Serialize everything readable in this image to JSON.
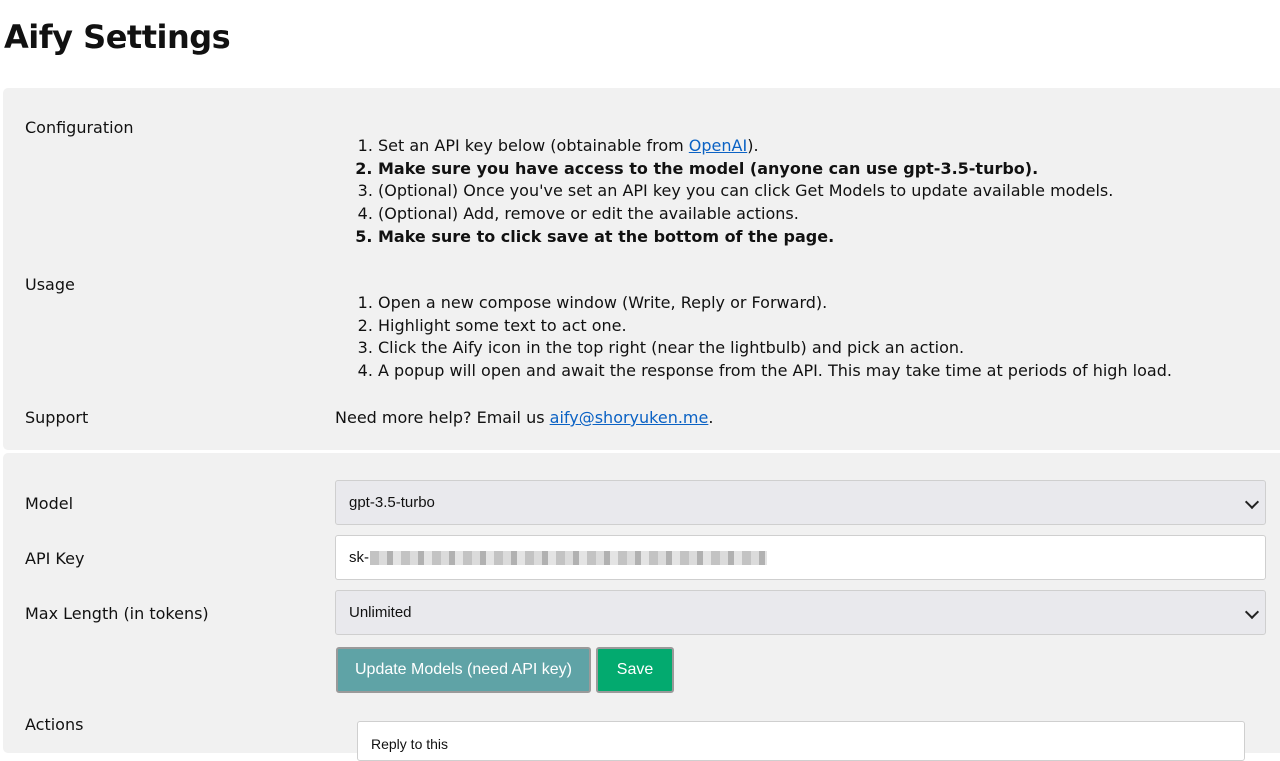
{
  "page": {
    "title": "Aify Settings"
  },
  "configuration": {
    "label": "Configuration",
    "steps": {
      "s1_pre": "Set an API key below (obtainable from ",
      "s1_link": "OpenAI",
      "s1_post": ").",
      "s2": "Make sure you have access to the model (anyone can use gpt-3.5-turbo).",
      "s3": "(Optional) Once you've set an API key you can click Get Models to update available models.",
      "s4": "(Optional) Add, remove or edit the available actions.",
      "s5": "Make sure to click save at the bottom of the page."
    }
  },
  "usage": {
    "label": "Usage",
    "steps": [
      "Open a new compose window (Write, Reply or Forward).",
      "Highlight some text to act one.",
      "Click the Aify icon in the top right (near the lightbulb) and pick an action.",
      "A popup will open and await the response from the API. This may take time at periods of high load."
    ]
  },
  "support": {
    "label": "Support",
    "text_pre": "Need more help? Email us ",
    "email": "aify@shoryuken.me",
    "text_post": "."
  },
  "settings": {
    "model_label": "Model",
    "model_value": "gpt-3.5-turbo",
    "api_key_label": "API Key",
    "api_key_prefix": "sk-",
    "max_length_label": "Max Length (in tokens)",
    "max_length_value": "Unlimited"
  },
  "buttons": {
    "update_models": "Update Models (need API key)",
    "save": "Save"
  },
  "actions": {
    "label": "Actions",
    "first_action": "Reply to this"
  },
  "colors": {
    "link": "#0b62c4",
    "update_button": "#5fa3a6",
    "save_button": "#03aa6f",
    "panel_background": "#f1f1f1"
  }
}
